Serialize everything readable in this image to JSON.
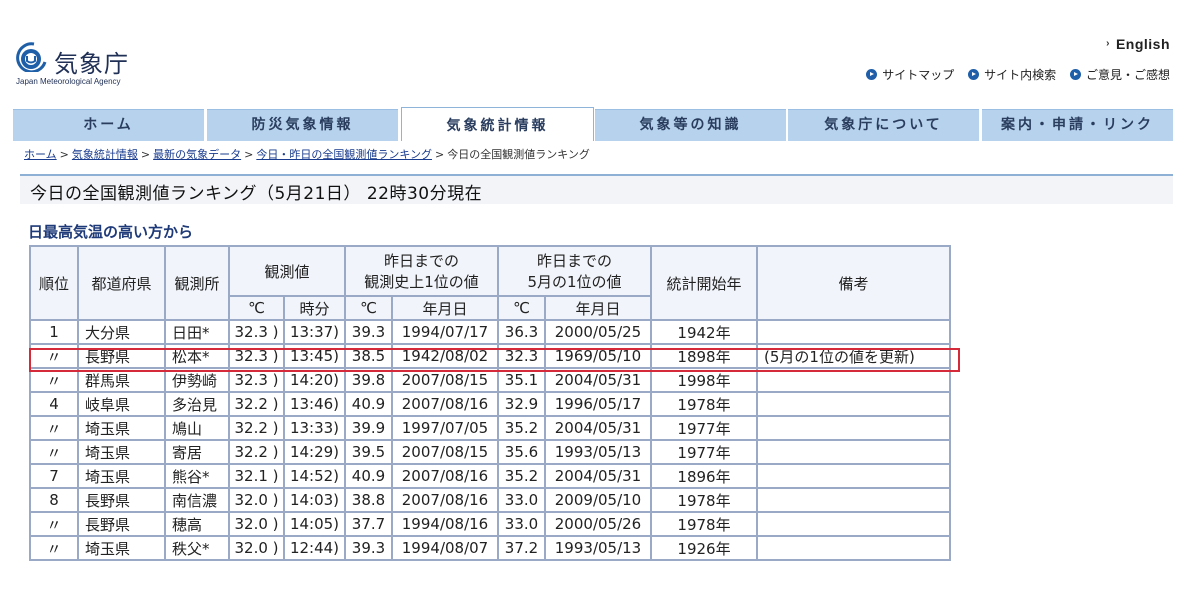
{
  "header": {
    "logo_title": "気象庁",
    "logo_sub": "Japan Meteorological Agency",
    "english_label": "English",
    "util_links": [
      "サイトマップ",
      "サイト内検索",
      "ご意見・ご感想"
    ]
  },
  "nav": {
    "tabs": [
      "ホーム",
      "防災気象情報",
      "気象統計情報",
      "気象等の知識",
      "気象庁について",
      "案内・申請・リンク"
    ]
  },
  "breadcrumb": [
    "ホーム",
    "気象統計情報",
    "最新の気象データ",
    "今日・昨日の全国観測値ランキング",
    "今日の全国観測値ランキング"
  ],
  "page_title": "今日の全国観測値ランキング（5月21日） 22時30分現在",
  "section_title": "日最高気温の高い方から",
  "table": {
    "h_rank": "順位",
    "h_pref": "都道府県",
    "h_station": "観測所",
    "h_obs": "観測値",
    "h_hist_1": "昨日までの",
    "h_hist_2": "観測史上1位の値",
    "h_may_1": "昨日までの",
    "h_may_2": "5月の1位の値",
    "h_start": "統計開始年",
    "h_note": "備考",
    "h_c1": "℃",
    "h_time": "時分",
    "h_c2": "℃",
    "h_date1": "年月日",
    "h_c3": "℃",
    "h_date2": "年月日",
    "rows": [
      {
        "rank": "1",
        "pref": "大分県",
        "station": "日田*",
        "temp": "32.3 )",
        "time": "13:37)",
        "hist_temp": "39.3",
        "hist_date": "1994/07/17",
        "may_temp": "36.3",
        "may_date": "2000/05/25",
        "start": "1942年",
        "note": ""
      },
      {
        "rank": "〃",
        "pref": "長野県",
        "station": "松本*",
        "temp": "32.3 )",
        "time": "13:45)",
        "hist_temp": "38.5",
        "hist_date": "1942/08/02",
        "may_temp": "32.3",
        "may_date": "1969/05/10",
        "start": "1898年",
        "note": "(5月の1位の値を更新)"
      },
      {
        "rank": "〃",
        "pref": "群馬県",
        "station": "伊勢崎",
        "temp": "32.3 )",
        "time": "14:20)",
        "hist_temp": "39.8",
        "hist_date": "2007/08/15",
        "may_temp": "35.1",
        "may_date": "2004/05/31",
        "start": "1998年",
        "note": ""
      },
      {
        "rank": "4",
        "pref": "岐阜県",
        "station": "多治見",
        "temp": "32.2 )",
        "time": "13:46)",
        "hist_temp": "40.9",
        "hist_date": "2007/08/16",
        "may_temp": "32.9",
        "may_date": "1996/05/17",
        "start": "1978年",
        "note": ""
      },
      {
        "rank": "〃",
        "pref": "埼玉県",
        "station": "鳩山",
        "temp": "32.2 )",
        "time": "13:33)",
        "hist_temp": "39.9",
        "hist_date": "1997/07/05",
        "may_temp": "35.2",
        "may_date": "2004/05/31",
        "start": "1977年",
        "note": ""
      },
      {
        "rank": "〃",
        "pref": "埼玉県",
        "station": "寄居",
        "temp": "32.2 )",
        "time": "14:29)",
        "hist_temp": "39.5",
        "hist_date": "2007/08/15",
        "may_temp": "35.6",
        "may_date": "1993/05/13",
        "start": "1977年",
        "note": ""
      },
      {
        "rank": "7",
        "pref": "埼玉県",
        "station": "熊谷*",
        "temp": "32.1 )",
        "time": "14:52)",
        "hist_temp": "40.9",
        "hist_date": "2007/08/16",
        "may_temp": "35.2",
        "may_date": "2004/05/31",
        "start": "1896年",
        "note": ""
      },
      {
        "rank": "8",
        "pref": "長野県",
        "station": "南信濃",
        "temp": "32.0 )",
        "time": "14:03)",
        "hist_temp": "38.8",
        "hist_date": "2007/08/16",
        "may_temp": "33.0",
        "may_date": "2009/05/10",
        "start": "1978年",
        "note": ""
      },
      {
        "rank": "〃",
        "pref": "長野県",
        "station": "穂高",
        "temp": "32.0 )",
        "time": "14:05)",
        "hist_temp": "37.7",
        "hist_date": "1994/08/16",
        "may_temp": "33.0",
        "may_date": "2000/05/26",
        "start": "1978年",
        "note": ""
      },
      {
        "rank": "〃",
        "pref": "埼玉県",
        "station": "秩父*",
        "temp": "32.0 )",
        "time": "12:44)",
        "hist_temp": "39.3",
        "hist_date": "1994/08/07",
        "may_temp": "37.2",
        "may_date": "1993/05/13",
        "start": "1926年",
        "note": ""
      }
    ]
  }
}
